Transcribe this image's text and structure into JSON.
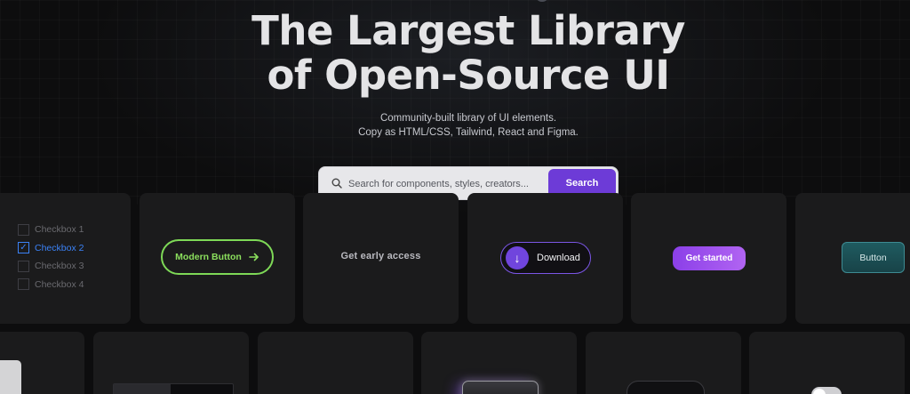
{
  "hero": {
    "title_line1": "The Largest Library",
    "title_line2": "of Open-Source UI",
    "subtitle_line1": "Community-built library of UI elements.",
    "subtitle_line2": "Copy as HTML/CSS, Tailwind, React and Figma."
  },
  "search": {
    "placeholder": "Search for components, styles, creators...",
    "button_label": "Search"
  },
  "cards": {
    "checkboxes": [
      {
        "label": "Checkbox 1",
        "checked": false
      },
      {
        "label": "Checkbox 2",
        "checked": true
      },
      {
        "label": "Checkbox 3",
        "checked": false
      },
      {
        "label": "Checkbox 4",
        "checked": false
      }
    ],
    "modern_button_label": "Modern Button",
    "early_access_label": "Get early access",
    "download_label": "Download",
    "get_started_label": "Get started",
    "teal_button_label": "Button"
  },
  "colors": {
    "accent_purple": "#6d3bd7",
    "accent_green": "#7ed957",
    "accent_blue": "#3b82f6",
    "accent_teal": "#1f5b60"
  },
  "icons": {
    "search": "search-icon",
    "arrow": "arrow-right-icon",
    "download": "arrow-down-icon",
    "check": "check-icon"
  }
}
